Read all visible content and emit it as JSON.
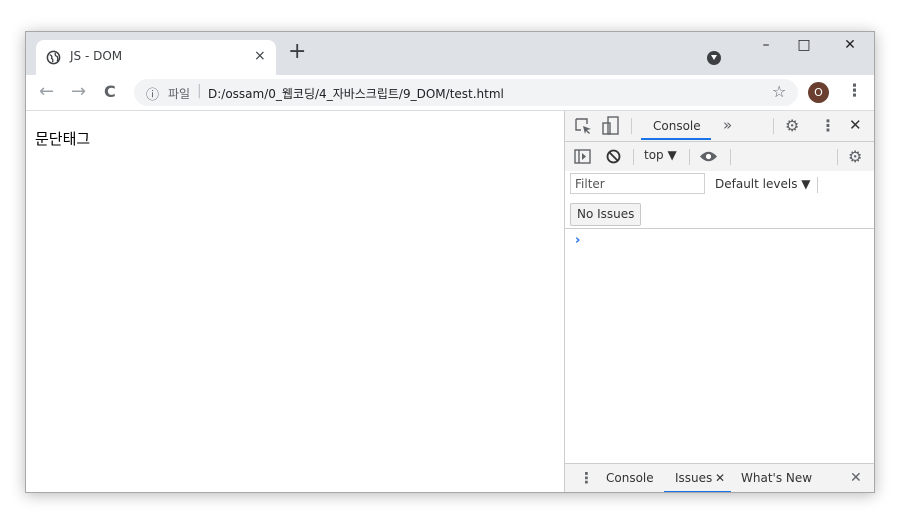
{
  "tab": {
    "title": "JS - DOM",
    "close_glyph": "×",
    "newtab_glyph": "+"
  },
  "window_controls": {
    "minimize": "–",
    "maximize": "□",
    "close": "✕"
  },
  "toolbar": {
    "back_glyph": "←",
    "forward_glyph": "→",
    "reload_glyph": "C",
    "info_glyph": "ⓘ",
    "scheme_label": "파일",
    "separator": "|",
    "url": "D:/ossam/0_웹코딩/4_자바스크립트/9_DOM/test.html",
    "star_glyph": "☆",
    "avatar_initial": "O",
    "menu_glyph": "⋮"
  },
  "page": {
    "paragraph": "문단태그"
  },
  "devtools": {
    "top_tab": "Console",
    "more_tabs_glyph": "»",
    "settings_glyph": "⚙",
    "menu_glyph": "⋮",
    "close_glyph": "✕",
    "context": "top ▼",
    "filter_placeholder": "Filter",
    "levels": "Default levels ▼",
    "issues_button": "No Issues",
    "prompt_glyph": "›",
    "drawer": {
      "menu_glyph": "⋮",
      "tab_console": "Console",
      "tab_issues": "Issues",
      "tab_issues_close": "✕",
      "tab_whatsnew": "What's New",
      "close_glyph": "✕"
    }
  },
  "colors": {
    "accent": "#1a73e8",
    "tabstrip": "#dee1e6",
    "avatar": "#6b3f2f"
  },
  "icons": [
    "globe-icon",
    "inspect-icon",
    "device-toolbar-icon",
    "sidebar-icon",
    "block-icon",
    "eye-icon",
    "gear-icon"
  ]
}
